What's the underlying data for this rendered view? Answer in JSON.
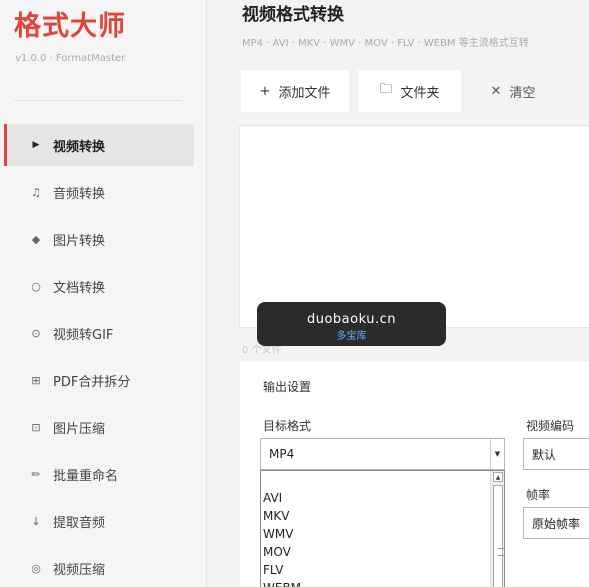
{
  "app": {
    "title": "格式大师",
    "version": "v1.0.0 · FormatMaster"
  },
  "sidebar": {
    "items": [
      {
        "icon": "▶",
        "icon_name": "play-icon",
        "label": "视频转换",
        "active": true
      },
      {
        "icon": "♫",
        "icon_name": "music-note-icon",
        "label": "音频转换",
        "active": false
      },
      {
        "icon": "◆",
        "icon_name": "diamond-icon",
        "label": "图片转换",
        "active": false
      },
      {
        "icon": "○",
        "icon_name": "circle-icon",
        "label": "文档转换",
        "active": false
      },
      {
        "icon": "⊙",
        "icon_name": "target-icon",
        "label": "视频转GIF",
        "active": false
      },
      {
        "icon": "⊞",
        "icon_name": "grid-icon",
        "label": "PDF合并拆分",
        "active": false
      },
      {
        "icon": "⊡",
        "icon_name": "compress-icon",
        "label": "图片压缩",
        "active": false
      },
      {
        "icon": "✏",
        "icon_name": "pencil-icon",
        "label": "批量重命名",
        "active": false
      },
      {
        "icon": "↓",
        "icon_name": "arrow-down-icon",
        "label": "提取音频",
        "active": false
      },
      {
        "icon": "◎",
        "icon_name": "ring-icon",
        "label": "视频压缩",
        "active": false
      }
    ]
  },
  "main": {
    "title": "视频格式转换",
    "subtitle": "MP4 · AVI · MKV · WMV · MOV · FLV · WEBM 等主流格式互转",
    "toolbar": {
      "add_icon": "+",
      "add_label": "添加文件",
      "folder_icon": "🗀",
      "folder_label": "文件夹",
      "clear_icon": "✕",
      "clear_label": "清空"
    },
    "file_count": "0 个文件",
    "settings": {
      "title": "输出设置",
      "target_format_label": "目标格式",
      "target_format_value": "MP4",
      "dropdown_arrow": "▼",
      "format_options": [
        "AVI",
        "MKV",
        "WMV",
        "MOV",
        "FLV",
        "WEBM"
      ],
      "video_codec_label": "视频编码",
      "video_codec_value": "默认",
      "frame_rate_label": "帧率",
      "frame_rate_value": "原始帧率"
    }
  },
  "watermark": {
    "domain": "duobaoku.cn",
    "name": "多宝库"
  },
  "colors": {
    "accent": "#e0443c",
    "sidebar_bg": "#f5f5f5",
    "active_bg": "#e6e6e6"
  }
}
